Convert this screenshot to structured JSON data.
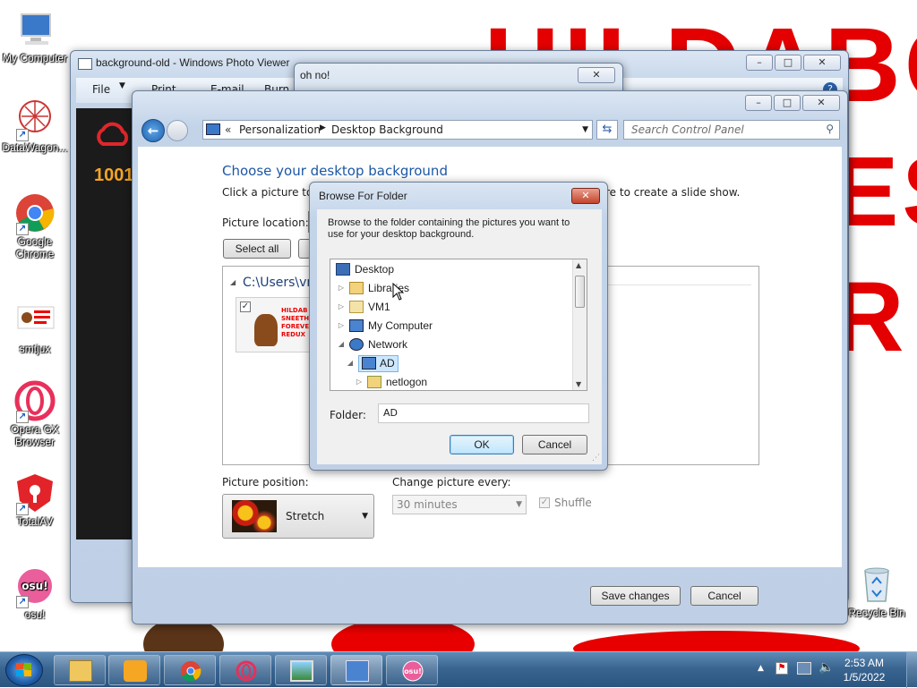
{
  "wallpaper": {
    "line1": "HILDABOO",
    "line2": "ES",
    "line3": "R"
  },
  "desktop_icons": [
    {
      "label": "My Computer",
      "icon": "computer-icon"
    },
    {
      "label": "DataWagon...",
      "icon": "datawagon-icon"
    },
    {
      "label": "Google Chrome",
      "icon": "chrome-icon"
    },
    {
      "label": "smtjux",
      "icon": "image-file-icon"
    },
    {
      "label": "Opera GX Browser",
      "icon": "opera-icon"
    },
    {
      "label": "TotalAV",
      "icon": "totalav-icon"
    },
    {
      "label": "osu!",
      "icon": "osu-icon"
    },
    {
      "label": "Recycle Bin",
      "icon": "recycle-bin-icon"
    }
  ],
  "photo_viewer": {
    "title": "background-old - Windows Photo Viewer",
    "menu": [
      "File",
      "Print",
      "E-mail",
      "Burn"
    ],
    "banner_text": "1001"
  },
  "oh_no": {
    "title": "oh no!"
  },
  "control_panel": {
    "breadcrumb": [
      "Personalization",
      "Desktop Background"
    ],
    "search_placeholder": "Search Control Panel",
    "heading": "Choose your desktop background",
    "instruction_start": "Click a picture to m",
    "instruction_end": "re to create a slide show.",
    "picture_location_label": "Picture location:",
    "select_all": "Select all",
    "folder_path": "C:\\Users\\vm",
    "thumbnail_text": "HILDAB SNEETH FOREVE REDUX",
    "picture_position_label": "Picture position:",
    "picture_position_value": "Stretch",
    "change_every_label": "Change picture every:",
    "change_every_value": "30 minutes",
    "shuffle_label": "Shuffle",
    "save_changes": "Save changes",
    "cancel": "Cancel"
  },
  "browse_dialog": {
    "title": "Browse For Folder",
    "description": "Browse to the folder containing the pictures you want to use for your desktop background.",
    "tree": [
      {
        "label": "Desktop",
        "icon": "desktop-folder-icon",
        "indent": 0,
        "expander": ""
      },
      {
        "label": "Libraries",
        "icon": "libraries-icon",
        "indent": 1,
        "expander": "▷"
      },
      {
        "label": "VM1",
        "icon": "user-folder-icon",
        "indent": 1,
        "expander": "▷"
      },
      {
        "label": "My Computer",
        "icon": "computer-icon",
        "indent": 1,
        "expander": "▷"
      },
      {
        "label": "Network",
        "icon": "network-icon",
        "indent": 1,
        "expander": "◢"
      },
      {
        "label": "AD",
        "icon": "network-computer-icon",
        "indent": 2,
        "expander": "◢"
      },
      {
        "label": "netlogon",
        "icon": "share-folder-icon",
        "indent": 3,
        "expander": "▷"
      }
    ],
    "selected": "AD",
    "folder_label": "Folder:",
    "folder_value": "AD",
    "ok": "OK",
    "cancel": "Cancel"
  },
  "taskbar": {
    "start": "start-orb-icon",
    "items": [
      "explorer-icon",
      "media-player-icon",
      "chrome-icon",
      "opera-icon",
      "photo-viewer-icon",
      "control-panel-icon",
      "osu-icon"
    ],
    "time": "2:53 AM",
    "date": "1/5/2022"
  }
}
